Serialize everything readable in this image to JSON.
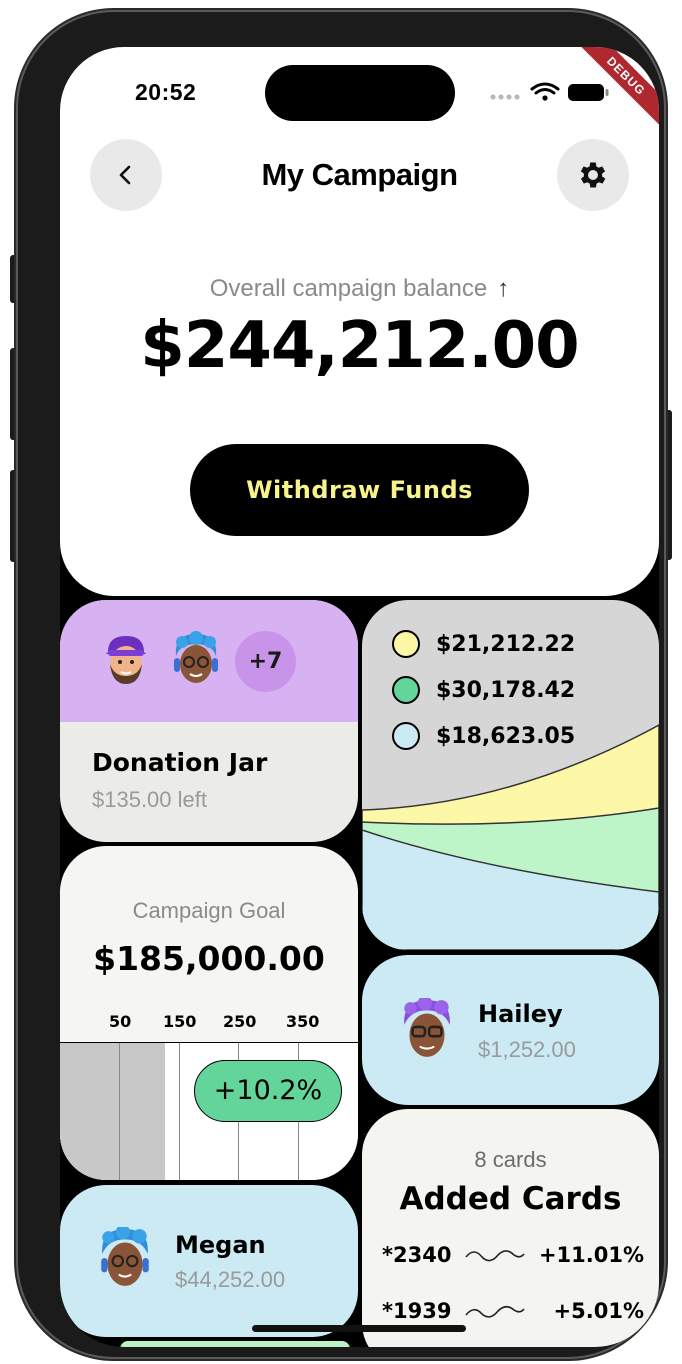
{
  "status_bar": {
    "time": "20:52",
    "debug_banner": "DEBUG"
  },
  "header": {
    "title": "My Campaign",
    "back_icon": "chevron-left-icon",
    "settings_icon": "gear-icon"
  },
  "balance": {
    "label": "Overall campaign balance",
    "arrow": "↑",
    "amount": "$244,212.00"
  },
  "withdraw_button": {
    "label": "Withdraw Funds",
    "text_color": "#f7f48e"
  },
  "donation_jar": {
    "extra_count": "+7",
    "title": "Donation Jar",
    "subtitle": "$135.00 left",
    "accent": "#d7b2f3"
  },
  "breakdown": {
    "items": [
      {
        "value": "$21,212.22",
        "color": "#fdf8a8"
      },
      {
        "value": "$30,178.42",
        "color": "#63d49a"
      },
      {
        "value": "$18,623.05",
        "color": "#cbeaf4"
      }
    ]
  },
  "goal": {
    "label": "Campaign Goal",
    "amount": "$185,000.00",
    "ticks": [
      "50",
      "150",
      "250",
      "350"
    ],
    "change": "+10.2%"
  },
  "people": [
    {
      "name": "Hailey",
      "amount": "$1,252.00"
    },
    {
      "name": "Megan",
      "amount": "$44,252.00"
    }
  ],
  "cards": {
    "count_label": "8 cards",
    "title": "Added Cards",
    "items": [
      {
        "number": "*2340",
        "change": "+11.01%"
      },
      {
        "number": "*1939",
        "change": "+5.01%"
      }
    ]
  }
}
